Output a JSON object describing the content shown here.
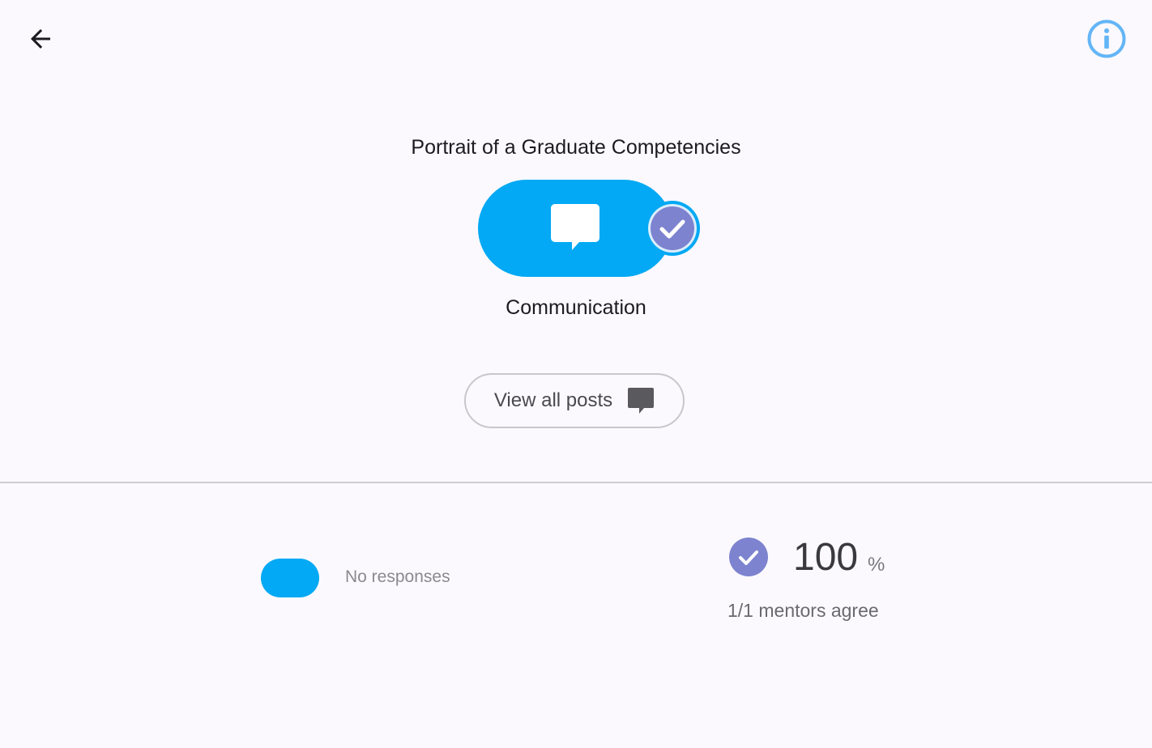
{
  "header": {
    "back_icon": "arrow-left-icon",
    "info_icon": "info-icon"
  },
  "competencies": {
    "title": "Portrait of a Graduate Competencies",
    "selected": {
      "name": "Communication",
      "icon": "chat-bubble-icon",
      "status_icon": "check-circle-icon",
      "pill_color": "#03a9f4",
      "check_color": "#7d83cf"
    },
    "view_posts_label": "View all posts",
    "view_posts_icon": "chat-bubble-icon"
  },
  "stats": {
    "responses_label": "No responses",
    "agree_icon": "check-circle-icon",
    "percent": "100",
    "percent_unit": "%",
    "mentors_agree": "1/1 mentors agree"
  },
  "colors": {
    "accent": "#03a9f4",
    "check": "#7d83cf",
    "info": "#64b5f6",
    "background": "#fbf9fd"
  }
}
